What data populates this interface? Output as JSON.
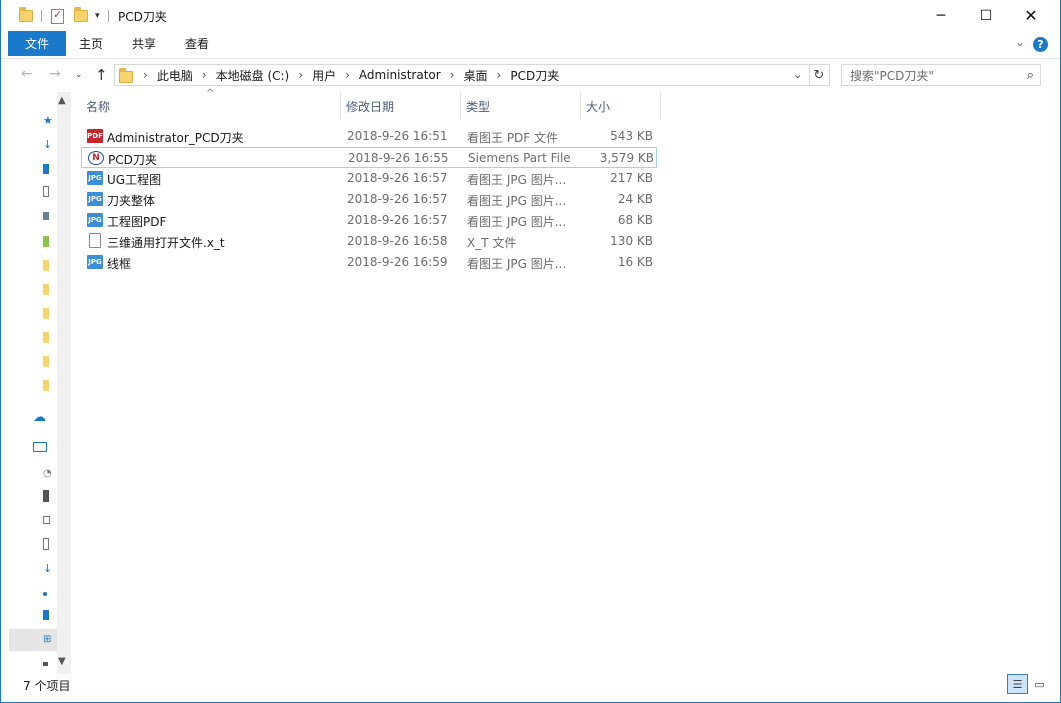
{
  "window": {
    "title": "PCD刀夹"
  },
  "ribbon": {
    "tabs": [
      "文件",
      "主页",
      "共享",
      "查看"
    ]
  },
  "address": {
    "crumbs": [
      "此电脑",
      "本地磁盘 (C:)",
      "用户",
      "Administrator",
      "桌面",
      "PCD刀夹"
    ],
    "search_placeholder": "搜索\"PCD刀夹\""
  },
  "columns": [
    "名称",
    "修改日期",
    "类型",
    "大小"
  ],
  "files": [
    {
      "name": "Administrator_PCD刀夹",
      "date": "2018-9-26 16:51",
      "type": "看图王 PDF 文件",
      "size": "543 KB",
      "icon": "pdf-icon"
    },
    {
      "name": "PCD刀夹",
      "date": "2018-9-26 16:55",
      "type": "Siemens Part File",
      "size": "3,579 KB",
      "icon": "siemens-part-icon"
    },
    {
      "name": "UG工程图",
      "date": "2018-9-26 16:57",
      "type": "看图王 JPG 图片...",
      "size": "217 KB",
      "icon": "jpg-icon"
    },
    {
      "name": "刀夹整体",
      "date": "2018-9-26 16:57",
      "type": "看图王 JPG 图片...",
      "size": "24 KB",
      "icon": "jpg-icon"
    },
    {
      "name": "工程图PDF",
      "date": "2018-9-26 16:57",
      "type": "看图王 JPG 图片...",
      "size": "68 KB",
      "icon": "jpg-icon"
    },
    {
      "name": "三维通用打开文件.x_t",
      "date": "2018-9-26 16:58",
      "type": "X_T 文件",
      "size": "130 KB",
      "icon": "document-icon"
    },
    {
      "name": "线框",
      "date": "2018-9-26 16:59",
      "type": "看图王 JPG 图片...",
      "size": "16 KB",
      "icon": "jpg-icon"
    }
  ],
  "status": {
    "item_count": "7 个项目"
  },
  "colors": {
    "accent": "#1979ca",
    "selection_border": "#99d1ff"
  }
}
